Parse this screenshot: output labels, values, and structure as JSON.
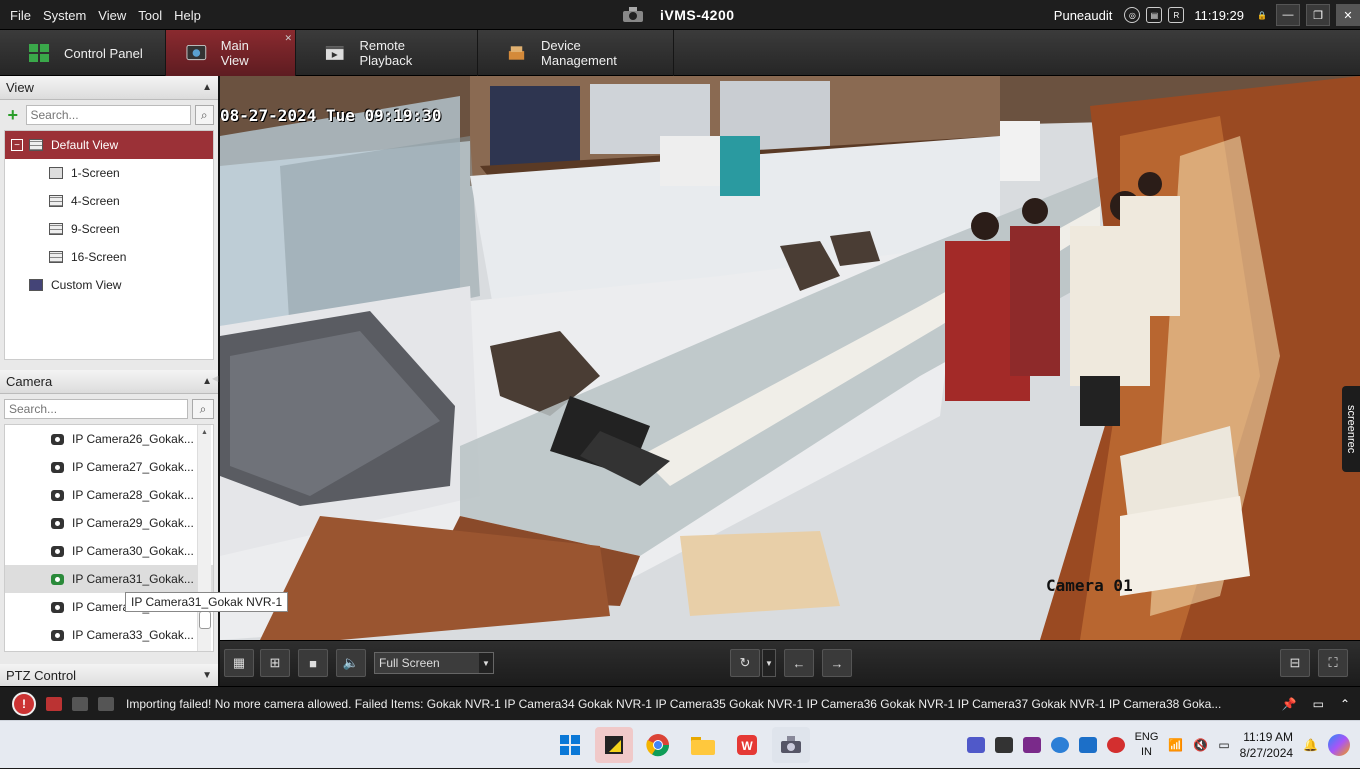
{
  "menu": [
    "File",
    "System",
    "View",
    "Tool",
    "Help"
  ],
  "app_title": "iVMS-4200",
  "user": "Puneaudit",
  "time": "11:19:29",
  "tabs": [
    {
      "label": "Control Panel"
    },
    {
      "label": "Main View",
      "active": true
    },
    {
      "label": "Remote Playback"
    },
    {
      "label": "Device Management"
    }
  ],
  "view_panel": {
    "title": "View",
    "search_placeholder": "Search...",
    "tree": [
      {
        "label": "Default View",
        "selected": true
      },
      {
        "label": "1-Screen"
      },
      {
        "label": "4-Screen"
      },
      {
        "label": "9-Screen"
      },
      {
        "label": "16-Screen"
      },
      {
        "label": "Custom View"
      }
    ]
  },
  "camera_panel": {
    "title": "Camera",
    "search_placeholder": "Search...",
    "items": [
      "IP Camera26_Gokak...",
      "IP Camera27_Gokak...",
      "IP Camera28_Gokak...",
      "IP Camera29_Gokak...",
      "IP Camera30_Gokak...",
      "IP Camera31_Gokak...",
      "IP Camera32_Gokak...",
      "IP Camera33_Gokak..."
    ],
    "tooltip": "IP Camera31_Gokak NVR-1"
  },
  "ptz_title": "PTZ Control",
  "video": {
    "timestamp": "08-27-2024 Tue 09:19:30",
    "camera_label": "Camera 01"
  },
  "controls": {
    "screen_mode": "Full Screen"
  },
  "status_message": "Importing failed! No more camera allowed. Failed Items: Gokak NVR-1 IP Camera34 Gokak NVR-1 IP Camera35 Gokak NVR-1 IP Camera36 Gokak NVR-1 IP Camera37 Gokak NVR-1 IP Camera38 Goka...",
  "screenrec_label": "screenrec",
  "taskbar": {
    "lang": "ENG",
    "region": "IN",
    "clock_time": "11:19 AM",
    "clock_date": "8/27/2024"
  },
  "colors": {
    "accent": "#9b3137",
    "panel_bg": "#e9e9e9"
  }
}
